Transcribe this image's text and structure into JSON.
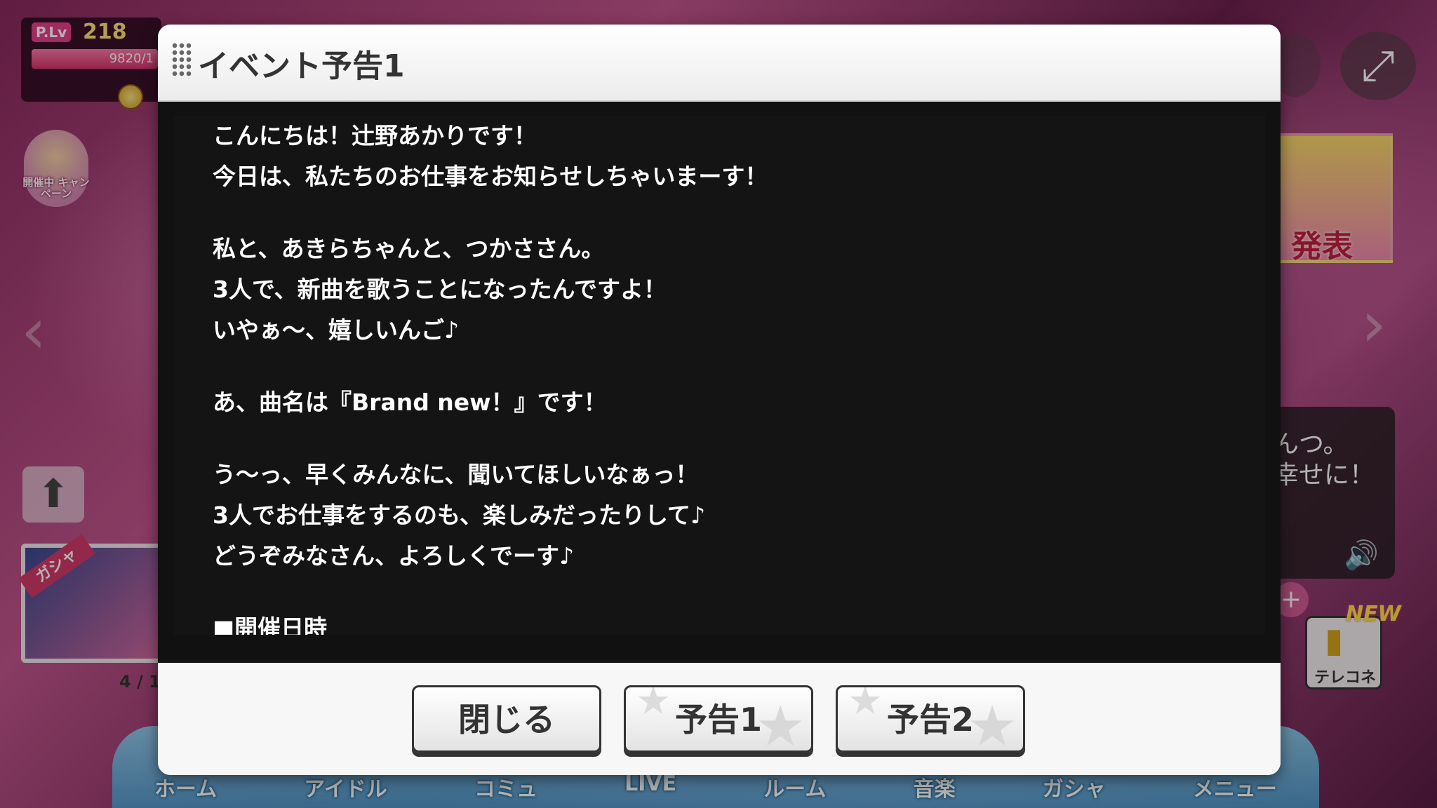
{
  "hud": {
    "plv_tag": "P.Lv",
    "plv_value": "218",
    "exp_text": "9820/1"
  },
  "campaign": {
    "label": "開催中 キャンペーン"
  },
  "gacha": {
    "tag": "ガシャ",
    "page": "4 / 1"
  },
  "banner": {
    "text": "発表"
  },
  "speech": {
    "lines": [
      "んつ。",
      "幸せに！"
    ]
  },
  "telecone": {
    "label": "テレコネ",
    "badge": "NEW"
  },
  "bottom_nav": [
    "ホーム",
    "アイドル",
    "コミュ",
    "LIVE",
    "ルーム",
    "音楽",
    "ガシャ",
    "メニュー"
  ],
  "dialog": {
    "title": "イベント予告1",
    "message": {
      "para1": [
        "こんにちは！辻野あかりです！",
        "今日は、私たちのお仕事をお知らせしちゃいまーす！"
      ],
      "para2": [
        "私と、あきらちゃんと、つかささん。",
        "3人で、新曲を歌うことになったんですよ！",
        "いやぁ～、嬉しいんご♪"
      ],
      "para3": [
        "あ、曲名は『Brand new！』です！"
      ],
      "para4": [
        "う～っ、早くみんなに、聞いてほしいなぁっ！",
        "3人でお仕事をするのも、楽しみだったりして♪",
        "どうぞみなさん、よろしくでーす♪"
      ],
      "para5": [
        "■開催日時"
      ]
    },
    "buttons": {
      "close": "閉じる",
      "notice1": "予告1",
      "notice2": "予告2"
    }
  }
}
